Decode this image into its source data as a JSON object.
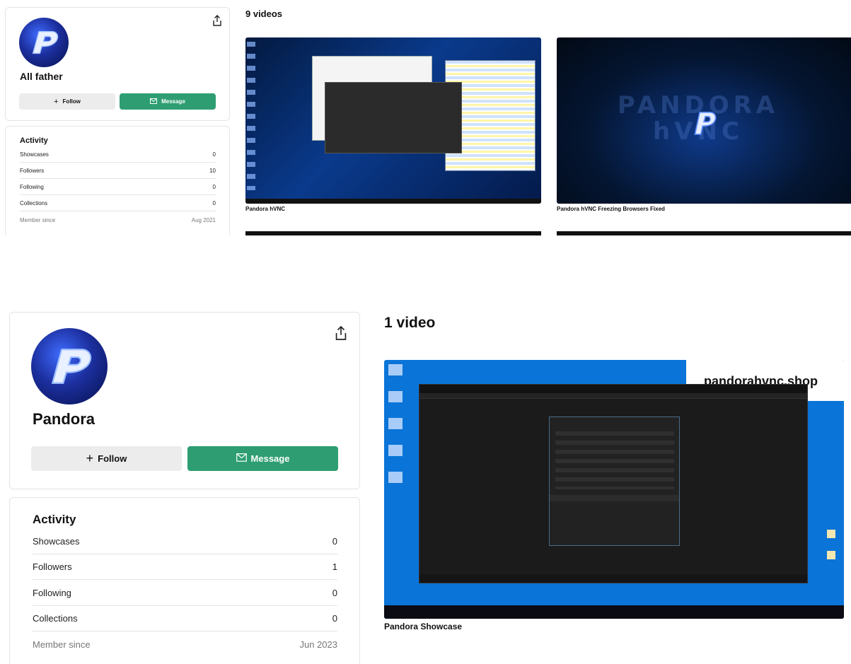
{
  "top": {
    "profile": {
      "name": "All father",
      "follow_label": "Follow",
      "message_label": "Message"
    },
    "activity": {
      "title": "Activity",
      "rows": [
        {
          "label": "Showcases",
          "value": "0"
        },
        {
          "label": "Followers",
          "value": "10"
        },
        {
          "label": "Following",
          "value": "0"
        },
        {
          "label": "Collections",
          "value": "0"
        },
        {
          "label": "Member since",
          "value": "Aug 2021"
        }
      ]
    },
    "videos": {
      "count_label": "9 videos",
      "items": [
        {
          "title": "Pandora hVNC"
        },
        {
          "title": "Pandora hVNC Freezing Browsers Fixed",
          "banner": "PANDORA hVNC"
        }
      ]
    }
  },
  "bottom": {
    "profile": {
      "name": "Pandora",
      "follow_label": "Follow",
      "message_label": "Message"
    },
    "activity": {
      "title": "Activity",
      "rows": [
        {
          "label": "Showcases",
          "value": "0"
        },
        {
          "label": "Followers",
          "value": "1"
        },
        {
          "label": "Following",
          "value": "0"
        },
        {
          "label": "Collections",
          "value": "0"
        },
        {
          "label": "Member since",
          "value": "Jun 2023"
        }
      ]
    },
    "videos": {
      "count_label": "1 video",
      "items": [
        {
          "title": "Pandora Showcase",
          "watermark": "pandorahvnc.shop"
        }
      ]
    }
  },
  "colors": {
    "message_green": "#2e9e72",
    "follow_gray": "#ececec",
    "desktop_blue": "#0a74d8"
  }
}
